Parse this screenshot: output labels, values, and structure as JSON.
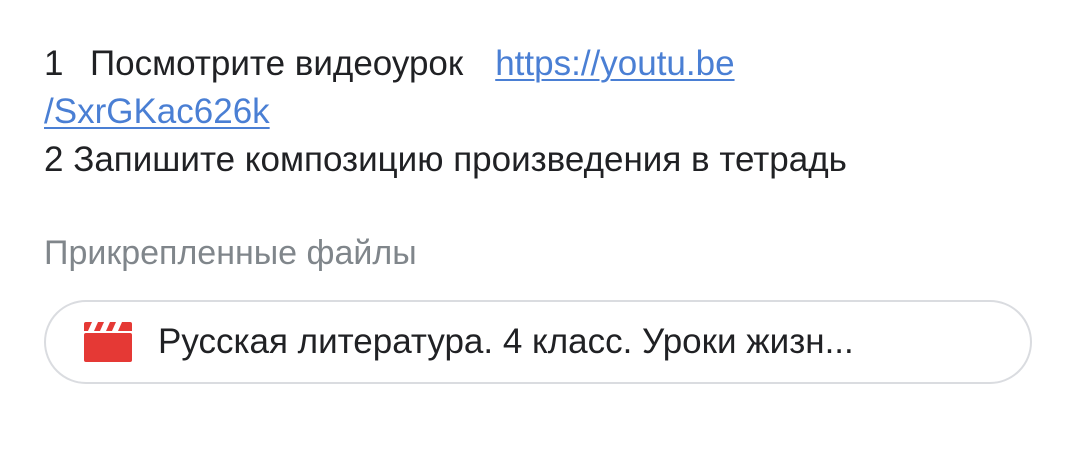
{
  "instructions": {
    "item1_number": "1",
    "item1_text": "Посмотрите видеоурок",
    "item1_link_part1": "https://youtu.be",
    "item1_link_part2": "/SxrGKac626k",
    "item2_number": "2",
    "item2_text": "Запишите композицию произведения в тетрадь"
  },
  "attachments": {
    "heading": "Прикрепленные файлы",
    "items": [
      {
        "icon": "video-clapperboard-icon",
        "title": "Русская литература. 4 класс. Уроки жизн..."
      }
    ]
  },
  "colors": {
    "link": "#4a7fd4",
    "video_icon": "#e53935",
    "muted_text": "#80868b"
  }
}
